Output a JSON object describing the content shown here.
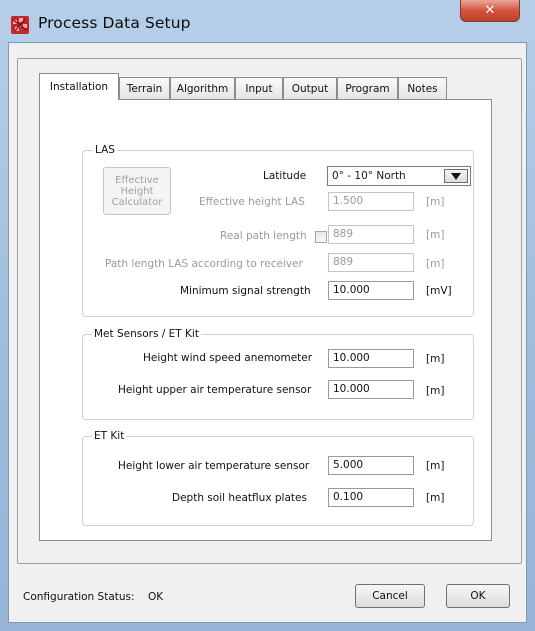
{
  "window": {
    "title": "Process Data Setup",
    "close_symbol": "✕"
  },
  "tabs": [
    {
      "label": "Installation",
      "active": true
    },
    {
      "label": "Terrain",
      "active": false
    },
    {
      "label": "Algorithm",
      "active": false
    },
    {
      "label": "Input",
      "active": false
    },
    {
      "label": "Output",
      "active": false
    },
    {
      "label": "Program",
      "active": false
    },
    {
      "label": "Notes",
      "active": false
    }
  ],
  "las": {
    "title": "LAS",
    "calculator_button": "Effective Height Calculator",
    "latitude_label": "Latitude",
    "latitude_value": "0° - 10° North",
    "effective_height_label": "Effective height LAS",
    "effective_height_value": "1.500",
    "effective_height_unit": "[m]",
    "real_path_label": "Real path length",
    "real_path_checked": false,
    "real_path_value": "889",
    "real_path_unit": "[m]",
    "path_receiver_label": "Path length LAS according to receiver",
    "path_receiver_value": "889",
    "path_receiver_unit": "[m]",
    "min_signal_label": "Minimum signal strength",
    "min_signal_value": "10.000",
    "min_signal_unit": "[mV]"
  },
  "met": {
    "title": "Met Sensors / ET Kit",
    "wind_label": "Height wind speed anemometer",
    "wind_value": "10.000",
    "wind_unit": "[m]",
    "upper_temp_label": "Height upper air temperature sensor",
    "upper_temp_value": "10.000",
    "upper_temp_unit": "[m]"
  },
  "etkit": {
    "title": "ET Kit",
    "lower_temp_label": "Height lower air temperature sensor",
    "lower_temp_value": "5.000",
    "lower_temp_unit": "[m]",
    "depth_label": "Depth soil heatflux plates",
    "depth_value": "0.100",
    "depth_unit": "[m]"
  },
  "footer": {
    "status_label": "Configuration Status:",
    "status_value": "OK",
    "cancel_label": "Cancel",
    "ok_label": "OK"
  },
  "colors": {
    "title_bar": "#9ebbdc",
    "close_button": "#d2533e",
    "disabled_text": "#9a9a9a"
  }
}
